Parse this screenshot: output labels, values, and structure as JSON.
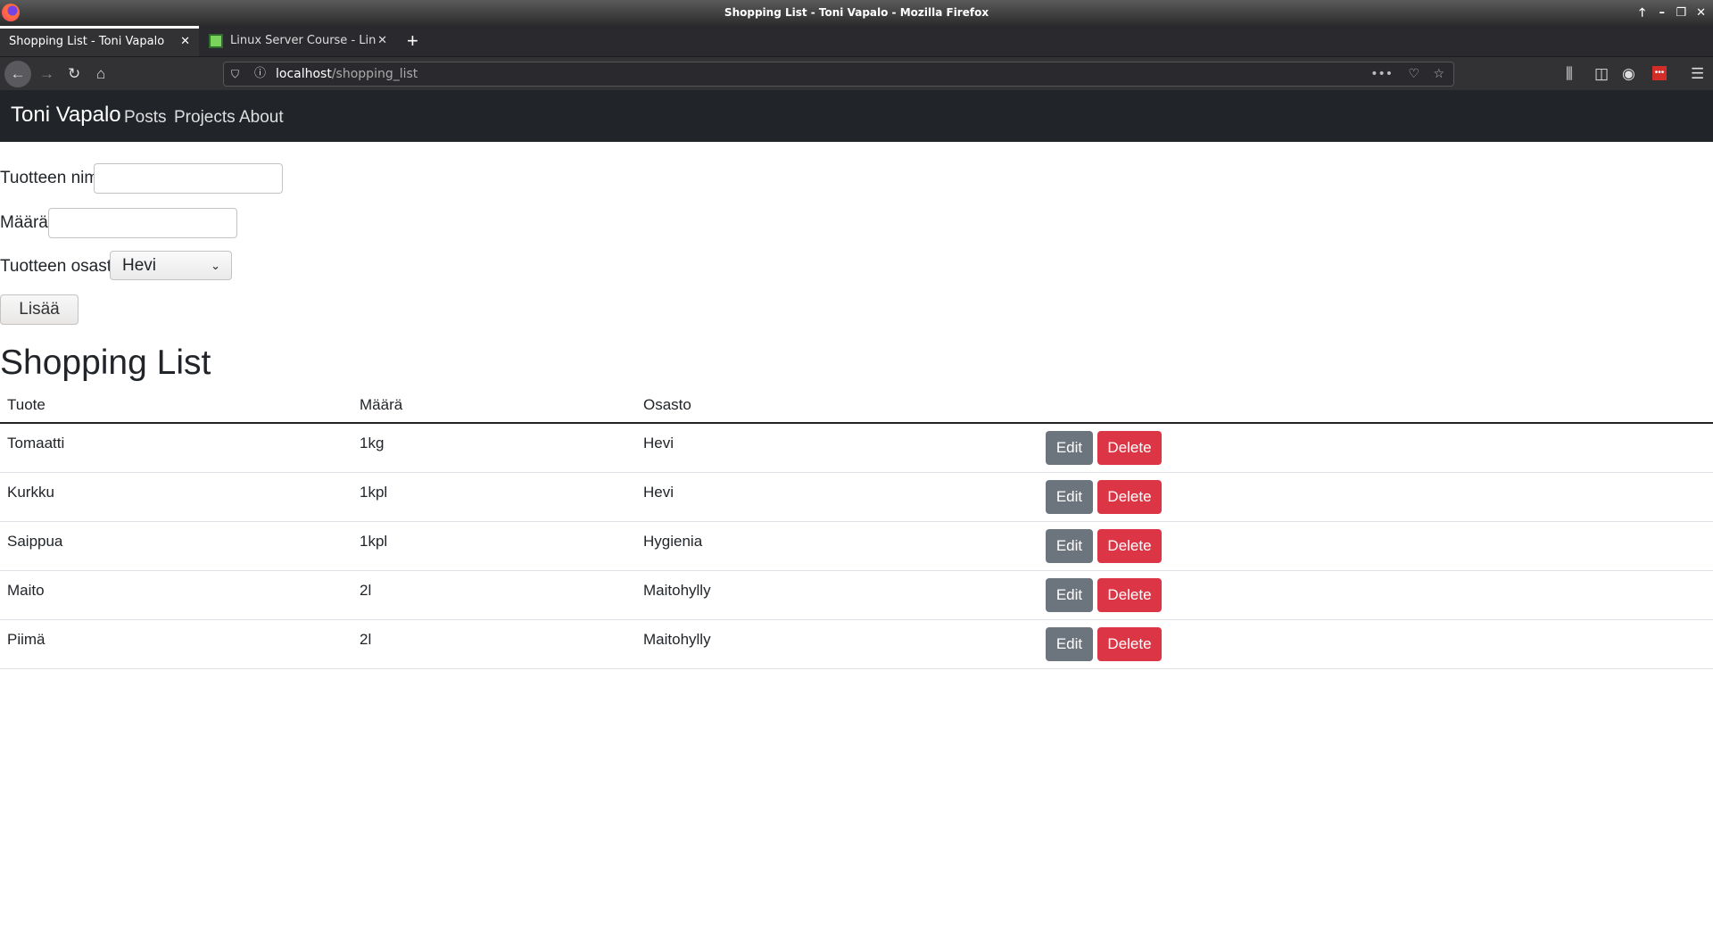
{
  "window": {
    "title": "Shopping List - Toni Vapalo - Mozilla Firefox"
  },
  "tabs": [
    {
      "label": "Shopping List - Toni Vapalo",
      "active": true
    },
    {
      "label": "Linux Server Course - Lin",
      "active": false
    }
  ],
  "url": {
    "host": "localhost",
    "path": "/shopping_list"
  },
  "site_nav": {
    "brand": "Toni Vapalo",
    "links": [
      "Posts",
      "Projects",
      "About"
    ]
  },
  "form": {
    "name_label": "Tuotteen nimi:",
    "name_value": "",
    "amount_label": "Määrä:",
    "amount_value": "",
    "dept_label": "Tuotteen osasto:",
    "dept_selected": "Hevi",
    "submit": "Lisää"
  },
  "list": {
    "title": "Shopping List",
    "columns": [
      "Tuote",
      "Määrä",
      "Osasto"
    ],
    "rows": [
      {
        "product": "Tomaatti",
        "amount": "1kg",
        "dept": "Hevi"
      },
      {
        "product": "Kurkku",
        "amount": "1kpl",
        "dept": "Hevi"
      },
      {
        "product": "Saippua",
        "amount": "1kpl",
        "dept": "Hygienia"
      },
      {
        "product": "Maito",
        "amount": "2l",
        "dept": "Maitohylly"
      },
      {
        "product": "Piimä",
        "amount": "2l",
        "dept": "Maitohylly"
      }
    ],
    "edit_label": "Edit",
    "delete_label": "Delete"
  },
  "colors": {
    "navbar": "#212529",
    "edit": "#6c757d",
    "delete": "#dc3545"
  }
}
